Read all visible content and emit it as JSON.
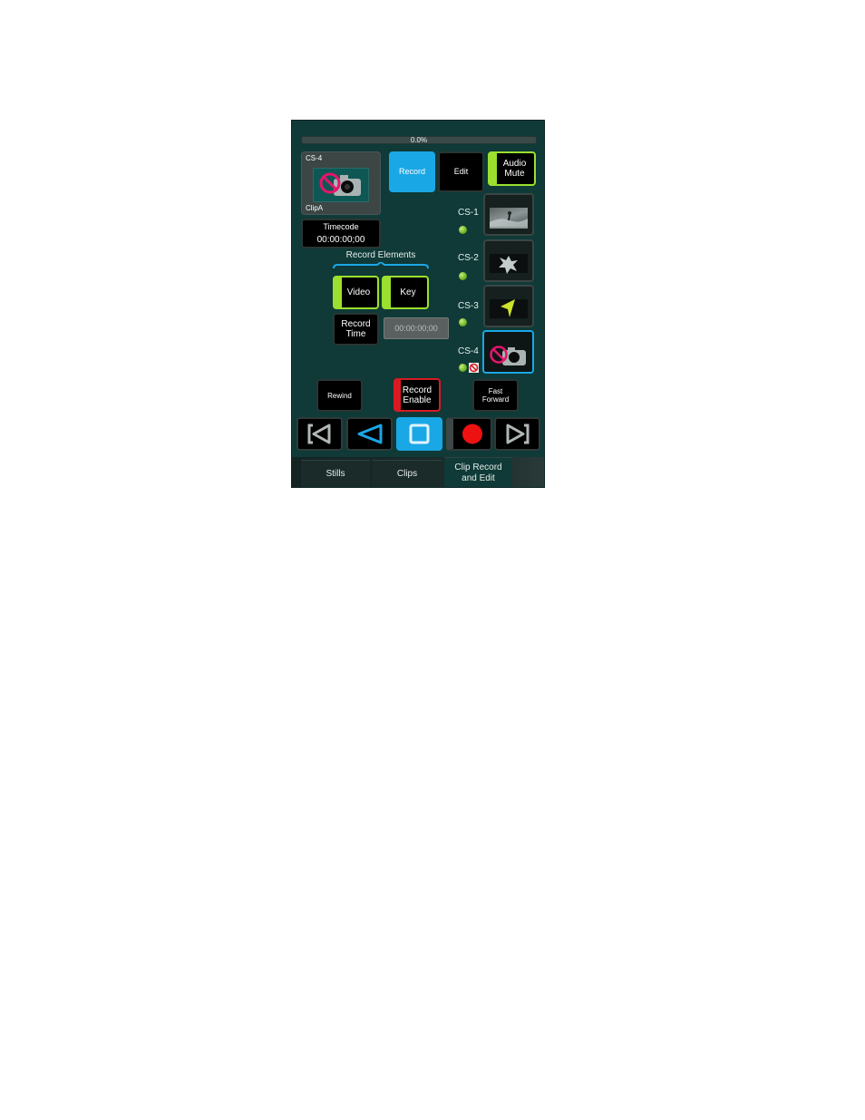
{
  "progress": {
    "label": "0.0%",
    "value": 0.0
  },
  "preview": {
    "source": "CS-4",
    "clip": "ClipA",
    "icon": "no-camera-icon"
  },
  "timecode": {
    "label": "Timecode",
    "value": "00:00:00;00"
  },
  "mode": {
    "record": "Record",
    "edit": "Edit",
    "audio_mute_line1": "Audio",
    "audio_mute_line2": "Mute"
  },
  "record_elements": {
    "title": "Record Elements",
    "video": "Video",
    "key": "Key"
  },
  "record_time": {
    "line1": "Record",
    "line2": "Time",
    "value": "00:00:00;00"
  },
  "sources": [
    {
      "label": "CS-1",
      "thumb": "surfer-thumbnail"
    },
    {
      "label": "CS-2",
      "thumb": "star-thumbnail"
    },
    {
      "label": "CS-3",
      "thumb": "arrow-thumbnail"
    },
    {
      "label": "CS-4",
      "thumb": "no-camera-icon"
    }
  ],
  "controls": {
    "rewind": "Rewind",
    "record_enable_line1": "Record",
    "record_enable_line2": "Enable",
    "ff_line1": "Fast",
    "ff_line2": "Forward"
  },
  "transport_icons": [
    "skip-to-start-icon",
    "play-reverse-icon",
    "stop-icon",
    "record-icon",
    "skip-to-end-icon"
  ],
  "tabs": [
    {
      "label": "Stills"
    },
    {
      "label": "Clips"
    },
    {
      "label_line1": "Clip Record",
      "label_line2": "and Edit"
    }
  ],
  "colors": {
    "accent_blue": "#1aa7e6",
    "accent_green": "#9be02e",
    "accent_red": "#d91a23",
    "panel": "#0f3a37"
  }
}
